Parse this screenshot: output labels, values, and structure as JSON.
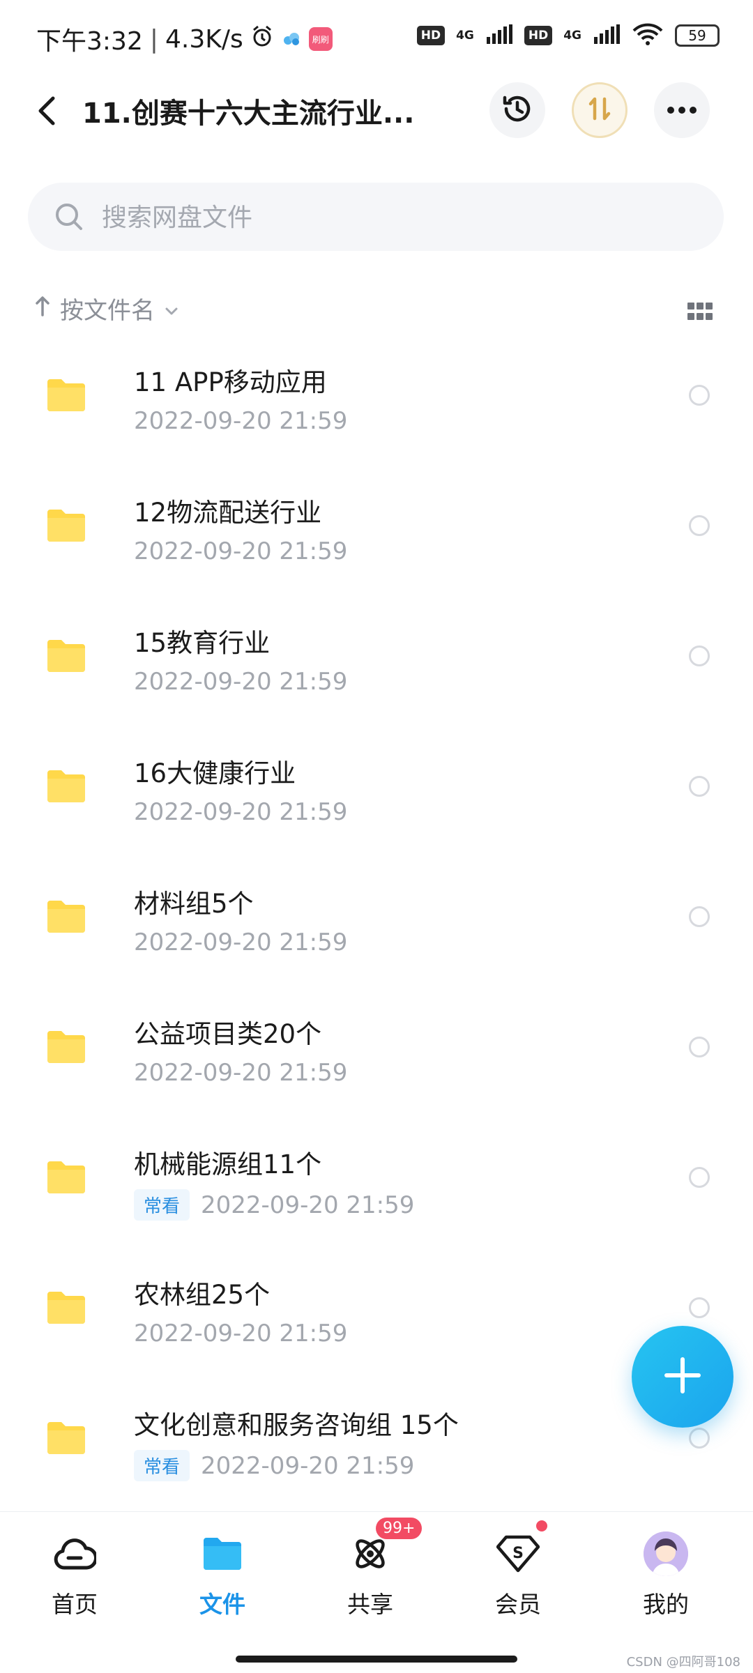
{
  "status_bar": {
    "time": "下午3:32",
    "net_speed": "4.3K/s",
    "hd_label": "HD",
    "network_type": "4G",
    "battery": "59",
    "app_icon_text": "刷刷"
  },
  "header": {
    "title": "11.创赛十六大主流行业...",
    "icons": [
      "back-icon",
      "history-icon",
      "transfer-icon",
      "more-icon"
    ]
  },
  "search": {
    "placeholder": "搜索网盘文件"
  },
  "sort": {
    "label": "按文件名"
  },
  "files": [
    {
      "name": "11 APP移动应用",
      "date": "2022-09-20  21:59",
      "tag": ""
    },
    {
      "name": "12物流配送行业",
      "date": "2022-09-20  21:59",
      "tag": ""
    },
    {
      "name": "15教育行业",
      "date": "2022-09-20  21:59",
      "tag": ""
    },
    {
      "name": "16大健康行业",
      "date": "2022-09-20  21:59",
      "tag": ""
    },
    {
      "name": "材料组5个",
      "date": "2022-09-20  21:59",
      "tag": ""
    },
    {
      "name": "公益项目类20个",
      "date": "2022-09-20  21:59",
      "tag": ""
    },
    {
      "name": "机械能源组11个",
      "date": "2022-09-20  21:59",
      "tag": "常看"
    },
    {
      "name": "农林组25个",
      "date": "2022-09-20  21:59",
      "tag": ""
    },
    {
      "name": "文化创意和服务咨询组 15个",
      "date": "2022-09-20  21:59",
      "tag": "常看"
    }
  ],
  "bottom_nav": [
    {
      "label": "首页",
      "icon": "cloud-icon",
      "active": false
    },
    {
      "label": "文件",
      "icon": "folder-icon",
      "active": true
    },
    {
      "label": "共享",
      "icon": "share-icon",
      "active": false,
      "badge": "99+"
    },
    {
      "label": "会员",
      "icon": "vip-icon",
      "active": false
    },
    {
      "label": "我的",
      "icon": "avatar",
      "active": false
    }
  ],
  "watermark": "CSDN @四阿哥108",
  "colors": {
    "accent": "#1b93e8",
    "folder": "#ffd84a",
    "badge": "#f24b63",
    "fab": "#1ba4ee"
  }
}
